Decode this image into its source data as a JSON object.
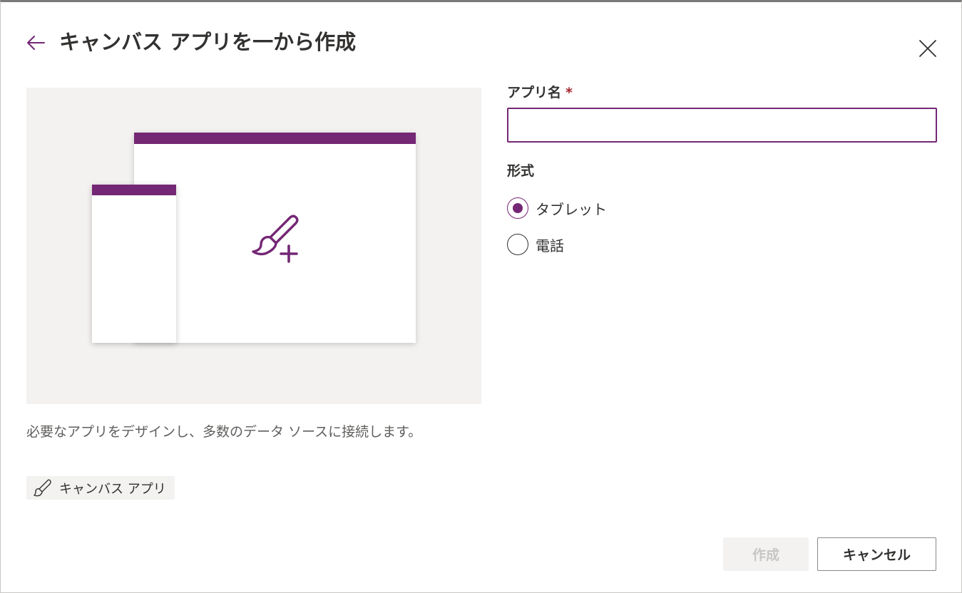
{
  "header": {
    "title": "キャンバス アプリを一から作成",
    "back_icon": "arrow-left-icon",
    "close_icon": "close-icon"
  },
  "illustration": {
    "icon": "paintbrush-add-icon"
  },
  "left": {
    "description": "必要なアプリをデザインし、多数のデータ ソースに接続します。",
    "tag_label": "キャンバス アプリ",
    "tag_icon": "paintbrush-icon"
  },
  "form": {
    "app_name_label": "アプリ名",
    "required_marker": "*",
    "app_name_value": "",
    "format_label": "形式",
    "format_options": [
      {
        "label": "タブレット",
        "selected": true
      },
      {
        "label": "電話",
        "selected": false
      }
    ]
  },
  "footer": {
    "create_label": "作成",
    "cancel_label": "キャンセル"
  },
  "colors": {
    "accent": "#742774",
    "required": "#a4262c",
    "illustration_bg": "#f3f2f1"
  }
}
